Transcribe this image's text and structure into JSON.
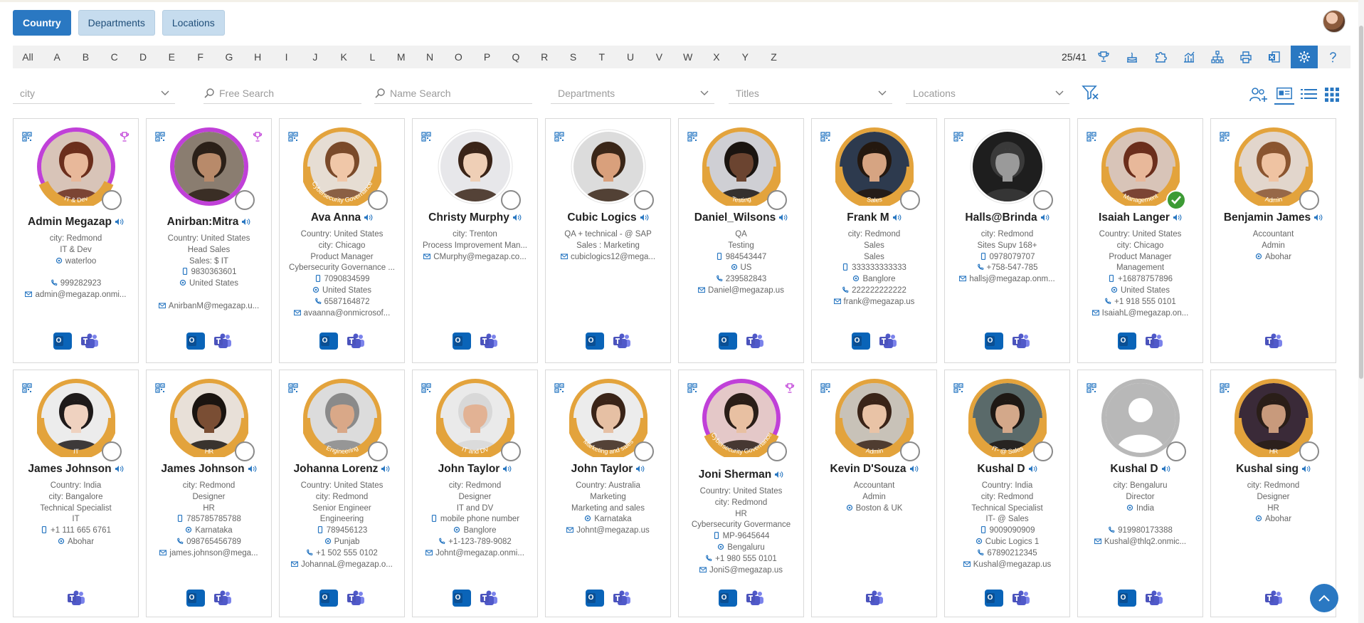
{
  "tabs": [
    {
      "label": "Country",
      "active": true
    },
    {
      "label": "Departments",
      "active": false
    },
    {
      "label": "Locations",
      "active": false
    }
  ],
  "alphabet": [
    "All",
    "A",
    "B",
    "C",
    "D",
    "E",
    "F",
    "G",
    "H",
    "I",
    "J",
    "K",
    "L",
    "M",
    "N",
    "O",
    "P",
    "Q",
    "R",
    "S",
    "T",
    "U",
    "V",
    "W",
    "X",
    "Y",
    "Z"
  ],
  "count": "25/41",
  "toolbar_icons": [
    "trophy-icon",
    "birthday-cake-icon",
    "puzzle-icon",
    "analytics-icon",
    "org-chart-icon",
    "print-icon",
    "excel-export-icon",
    "gear-icon",
    "help-icon"
  ],
  "filters": {
    "city": "city",
    "free_search": "Free Search",
    "name_search": "Name Search",
    "departments": "Departments",
    "titles": "Titles",
    "locations": "Locations"
  },
  "view_icons": [
    "add-group-icon",
    "card-view-icon",
    "list-view-icon",
    "grid-view-icon"
  ],
  "colors": {
    "accent": "#2a78c2",
    "ring_gold": "#e3a33c",
    "ring_purple": "#c040d8",
    "status_green": "#3d9b35"
  },
  "cards": [
    {
      "name": "Admin Megazap",
      "ring": "purple-gold",
      "ring_text": "IT & Dev",
      "trophy": true,
      "status": "none",
      "skin": "#e8b89a",
      "hair": "#6b2e1c",
      "bg": "#d8c4b8",
      "lines": [
        {
          "t": "city: Redmond"
        },
        {
          "t": "IT & Dev"
        },
        {
          "t": "waterloo",
          "i": "pin"
        },
        {
          "t": ""
        },
        {
          "t": "999282923",
          "i": "phone"
        },
        {
          "t": "admin@megazap.onmi...",
          "i": "mail"
        }
      ],
      "apps": [
        "outlook",
        "teams"
      ]
    },
    {
      "name": "Anirban:Mitra",
      "ring": "purple",
      "ring_text": "",
      "trophy": true,
      "status": "none",
      "skin": "#b88a6a",
      "hair": "#2b2018",
      "bg": "#8a7d70",
      "lines": [
        {
          "t": "Country: United States"
        },
        {
          "t": "Head Sales"
        },
        {
          "t": "Sales: $ IT"
        },
        {
          "t": "9830363601",
          "i": "mobile"
        },
        {
          "t": "United States",
          "i": "pin"
        },
        {
          "t": ""
        },
        {
          "t": "AnirbanM@megazap.u...",
          "i": "mail"
        }
      ],
      "apps": [
        "outlook",
        "teams"
      ]
    },
    {
      "name": "Ava Anna",
      "ring": "gold",
      "ring_text": "Cybersecurity Governance",
      "trophy": false,
      "status": "none",
      "skin": "#f0c7a8",
      "hair": "#7a4a2a",
      "bg": "#e6ddd3",
      "lines": [
        {
          "t": "Country: United States"
        },
        {
          "t": "city: Chicago"
        },
        {
          "t": "Product Manager"
        },
        {
          "t": "Cybersecurity Governance ..."
        },
        {
          "t": "7090834599",
          "i": "mobile"
        },
        {
          "t": "United States",
          "i": "pin"
        },
        {
          "t": "6587164872",
          "i": "phone"
        },
        {
          "t": "avaanna@onmicrosof...",
          "i": "mail"
        }
      ],
      "apps": [
        "outlook",
        "teams"
      ]
    },
    {
      "name": "Christy Murphy",
      "ring": "none",
      "ring_text": "",
      "trophy": false,
      "status": "none",
      "skin": "#efcfb6",
      "hair": "#3a2418",
      "bg": "#e7e7ea",
      "lines": [
        {
          "t": "city: Trenton"
        },
        {
          "t": "Process Improvement Man..."
        },
        {
          "t": "CMurphy@megazap.co...",
          "i": "mail"
        }
      ],
      "apps": [
        "outlook",
        "teams"
      ]
    },
    {
      "name": "Cubic Logics",
      "ring": "none",
      "ring_text": "",
      "trophy": false,
      "status": "none",
      "skin": "#d9a07c",
      "hair": "#3a2618",
      "bg": "#dcdcdc",
      "lines": [
        {
          "t": "QA + technical - @ SAP"
        },
        {
          "t": "Sales : Marketing"
        },
        {
          "t": "cubiclogics12@mega...",
          "i": "mail"
        }
      ],
      "apps": [
        "outlook",
        "teams"
      ]
    },
    {
      "name": "Daniel_Wilsons",
      "ring": "gold",
      "ring_text": "Testing",
      "trophy": false,
      "status": "none",
      "skin": "#6b4430",
      "hair": "#1a1410",
      "bg": "#cfcfd4",
      "lines": [
        {
          "t": "QA"
        },
        {
          "t": "Testing"
        },
        {
          "t": "984543447",
          "i": "mobile"
        },
        {
          "t": "US",
          "i": "pin"
        },
        {
          "t": "239582843",
          "i": "phone"
        },
        {
          "t": "Daniel@megazap.us",
          "i": "mail"
        }
      ],
      "apps": [
        "outlook",
        "teams"
      ]
    },
    {
      "name": "Frank M",
      "ring": "gold",
      "ring_text": "Sales",
      "trophy": false,
      "status": "none",
      "skin": "#d6a482",
      "hair": "#24180f",
      "bg": "#2d3a4e",
      "lines": [
        {
          "t": "city: Redmond"
        },
        {
          "t": "Sales"
        },
        {
          "t": "Sales"
        },
        {
          "t": "333333333333",
          "i": "mobile"
        },
        {
          "t": "Banglore",
          "i": "pin"
        },
        {
          "t": "222222222222",
          "i": "phone"
        },
        {
          "t": "frank@megazap.us",
          "i": "mail"
        }
      ],
      "apps": [
        "outlook",
        "teams"
      ]
    },
    {
      "name": "Halls@Brinda",
      "ring": "none",
      "ring_text": "",
      "trophy": false,
      "status": "none",
      "skin": "#9a9a9a",
      "hair": "#3a3a3a",
      "bg": "#1e1e1e",
      "lines": [
        {
          "t": "city: Redmond"
        },
        {
          "t": "Sites Supv 168+"
        },
        {
          "t": "0978079707",
          "i": "mobile"
        },
        {
          "t": "+758-547-785",
          "i": "phone"
        },
        {
          "t": "hallsj@megazap.onm...",
          "i": "mail"
        }
      ],
      "apps": [
        "outlook",
        "teams"
      ]
    },
    {
      "name": "Isaiah Langer",
      "ring": "gold",
      "ring_text": "Management",
      "trophy": false,
      "status": "ok",
      "skin": "#e8b89a",
      "hair": "#6b2e1c",
      "bg": "#d8c4b8",
      "lines": [
        {
          "t": "Country: United States"
        },
        {
          "t": "city: Chicago"
        },
        {
          "t": "Product Manager"
        },
        {
          "t": "Management"
        },
        {
          "t": "+16878757896",
          "i": "mobile"
        },
        {
          "t": "United States",
          "i": "pin"
        },
        {
          "t": "+1 918 555 0101",
          "i": "phone"
        },
        {
          "t": "IsaiahL@megazap.on...",
          "i": "mail"
        }
      ],
      "apps": [
        "outlook",
        "teams"
      ]
    },
    {
      "name": "Benjamin James",
      "ring": "gold",
      "ring_text": "Admin",
      "trophy": false,
      "status": "none",
      "skin": "#efc3a2",
      "hair": "#8a5530",
      "bg": "#e2d6cc",
      "lines": [
        {
          "t": "Accountant"
        },
        {
          "t": "Admin"
        },
        {
          "t": "Abohar",
          "i": "pin"
        }
      ],
      "apps": [
        "teams"
      ]
    },
    {
      "name": "James Johnson",
      "ring": "gold",
      "ring_text": "IT",
      "trophy": false,
      "status": "none",
      "skin": "#efd2c0",
      "hair": "#1e1a1a",
      "bg": "#ececec",
      "lines": [
        {
          "t": "Country: India"
        },
        {
          "t": "city: Bangalore"
        },
        {
          "t": "Technical Specialist"
        },
        {
          "t": "IT"
        },
        {
          "t": "+1 111 665 6761",
          "i": "mobile"
        },
        {
          "t": "Abohar",
          "i": "pin"
        }
      ],
      "apps": [
        "teams"
      ]
    },
    {
      "name": "James Johnson",
      "ring": "gold",
      "ring_text": "HR",
      "trophy": false,
      "status": "none",
      "skin": "#7a4e34",
      "hair": "#1a1410",
      "bg": "#e8e0d8",
      "lines": [
        {
          "t": "city: Redmond"
        },
        {
          "t": "Designer"
        },
        {
          "t": "HR"
        },
        {
          "t": "785785785788",
          "i": "mobile"
        },
        {
          "t": "Karnataka",
          "i": "pin"
        },
        {
          "t": "098765456789",
          "i": "phone"
        },
        {
          "t": "james.johnson@mega...",
          "i": "mail"
        }
      ],
      "apps": [
        "outlook",
        "teams"
      ]
    },
    {
      "name": "Johanna Lorenz",
      "ring": "gold",
      "ring_text": "Engineering",
      "trophy": false,
      "status": "none",
      "skin": "#d9a888",
      "hair": "#8a8a8a",
      "bg": "#dcdcdc",
      "lines": [
        {
          "t": "Country: United States"
        },
        {
          "t": "city: Redmond"
        },
        {
          "t": "Senior Engineer"
        },
        {
          "t": "Engineering"
        },
        {
          "t": "789456123",
          "i": "mobile"
        },
        {
          "t": "Punjab",
          "i": "pin"
        },
        {
          "t": "+1 502 555 0102",
          "i": "phone"
        },
        {
          "t": "JohannaL@megazap.o...",
          "i": "mail"
        }
      ],
      "apps": [
        "outlook",
        "teams"
      ]
    },
    {
      "name": "John Taylor",
      "ring": "gold",
      "ring_text": "IT and DV",
      "trophy": false,
      "status": "none",
      "skin": "#e2b294",
      "hair": "#d8d8d8",
      "bg": "#eaeaea",
      "lines": [
        {
          "t": "city: Redmond"
        },
        {
          "t": "Designer"
        },
        {
          "t": "IT and DV"
        },
        {
          "t": "mobile phone number",
          "i": "mobile"
        },
        {
          "t": "Banglore",
          "i": "pin"
        },
        {
          "t": "+1-123-789-9082",
          "i": "phone"
        },
        {
          "t": "Johnt@megazap.onmi...",
          "i": "mail"
        }
      ],
      "apps": [
        "outlook",
        "teams"
      ]
    },
    {
      "name": "John Taylor",
      "ring": "gold",
      "ring_text": "Marketing and sales",
      "trophy": false,
      "status": "none",
      "skin": "#e6c0a4",
      "hair": "#3a2418",
      "bg": "#ececec",
      "lines": [
        {
          "t": "Country: Australia"
        },
        {
          "t": "Marketing"
        },
        {
          "t": "Marketing and sales"
        },
        {
          "t": "Karnataka",
          "i": "pin"
        },
        {
          "t": "Johnt@megazap.us",
          "i": "mail"
        }
      ],
      "apps": [
        "outlook",
        "teams"
      ]
    },
    {
      "name": "Joni Sherman",
      "ring": "purple-gold",
      "ring_text": "Cybersecurity Governance",
      "trophy": true,
      "status": "none",
      "skin": "#e8c0a2",
      "hair": "#2a1e18",
      "bg": "#e4c8c8",
      "lines": [
        {
          "t": "Country: United States"
        },
        {
          "t": "city: Redmond"
        },
        {
          "t": "HR"
        },
        {
          "t": "Cybersecurity Govermance"
        },
        {
          "t": "MP-9645644",
          "i": "mobile"
        },
        {
          "t": "Bengaluru",
          "i": "pin"
        },
        {
          "t": "+1 980 555 0101",
          "i": "phone"
        },
        {
          "t": "JoniS@megazap.us",
          "i": "mail"
        }
      ],
      "apps": [
        "outlook",
        "teams"
      ]
    },
    {
      "name": "Kevin D'Souza",
      "ring": "gold",
      "ring_text": "Admin",
      "trophy": false,
      "status": "none",
      "skin": "#e9c3a6",
      "hair": "#3a2418",
      "bg": "#c8c2b8",
      "lines": [
        {
          "t": "Accountant"
        },
        {
          "t": "Admin"
        },
        {
          "t": "Boston & UK",
          "i": "pin"
        }
      ],
      "apps": [
        "teams"
      ]
    },
    {
      "name": "Kushal D",
      "ring": "gold",
      "ring_text": "IT- @ Sales",
      "trophy": false,
      "status": "none",
      "skin": "#d3a88a",
      "hair": "#1e1814",
      "bg": "#5a6a6a",
      "lines": [
        {
          "t": "Country: India"
        },
        {
          "t": "city: Redmond"
        },
        {
          "t": "Technical Specialist"
        },
        {
          "t": "IT- @ Sales"
        },
        {
          "t": "9009090909",
          "i": "mobile"
        },
        {
          "t": "Cubic Logics 1",
          "i": "pin"
        },
        {
          "t": "67890212345",
          "i": "phone"
        },
        {
          "t": "Kushal@megazap.us",
          "i": "mail"
        }
      ],
      "apps": [
        "outlook",
        "teams"
      ]
    },
    {
      "name": "Kushal D",
      "ring": "placeholder",
      "ring_text": "",
      "trophy": false,
      "status": "none",
      "skin": "#ffffff",
      "hair": "#ffffff",
      "bg": "#b8b8b8",
      "lines": [
        {
          "t": "city: Bengaluru"
        },
        {
          "t": "Director"
        },
        {
          "t": "India",
          "i": "pin"
        },
        {
          "t": ""
        },
        {
          "t": "919980173388",
          "i": "phone"
        },
        {
          "t": "Kushal@thlq2.onmic...",
          "i": "mail"
        }
      ],
      "apps": [
        "outlook",
        "teams"
      ]
    },
    {
      "name": "Kushal sing",
      "ring": "gold",
      "ring_text": "HR",
      "trophy": false,
      "status": "none",
      "skin": "#c89a7c",
      "hair": "#2a1e18",
      "bg": "#3a2a38",
      "lines": [
        {
          "t": "city: Redmond"
        },
        {
          "t": "Designer"
        },
        {
          "t": "HR"
        },
        {
          "t": "Abohar",
          "i": "pin"
        }
      ],
      "apps": [
        "teams"
      ]
    }
  ]
}
